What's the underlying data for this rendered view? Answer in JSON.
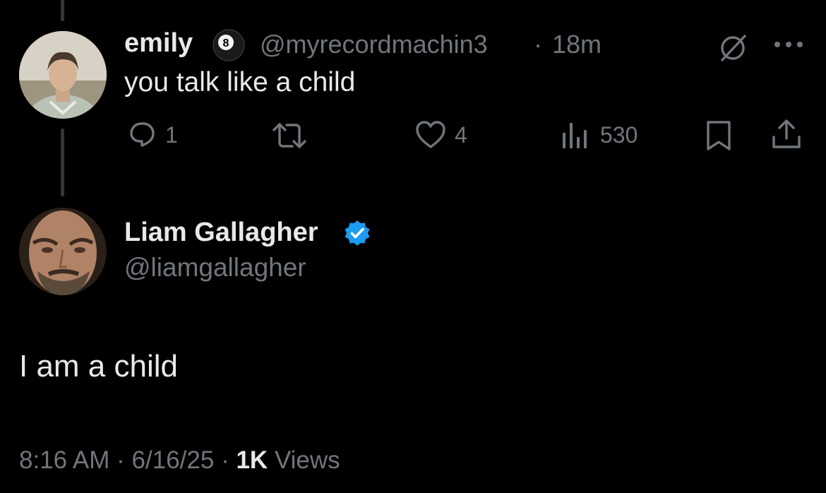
{
  "reply_tweet": {
    "display_name": "emily",
    "badge_emoji": "8-ball",
    "handle": "@myrecordmachin3",
    "separator": "·",
    "time_ago": "18m",
    "text": "you talk like a child",
    "actions": {
      "reply_count": "1",
      "retweet_count": "",
      "like_count": "4",
      "views_count": "530"
    },
    "icons": [
      "grok-icon",
      "more-icon",
      "reply-icon",
      "retweet-icon",
      "like-icon",
      "views-icon",
      "bookmark-icon",
      "share-icon"
    ]
  },
  "main_tweet": {
    "display_name": "Liam Gallagher",
    "verified": true,
    "handle": "@liamgallagher",
    "text": "I am a child",
    "timestamp": "8:16 AM",
    "sep1": "·",
    "date": "6/16/25",
    "sep2": "·",
    "views_count": "1K",
    "views_label": "Views"
  },
  "colors": {
    "background": "#000000",
    "text_primary": "#e7e9ea",
    "text_muted": "#71767b",
    "verified_blue": "#1d9bf0",
    "thread_line": "#333639"
  }
}
